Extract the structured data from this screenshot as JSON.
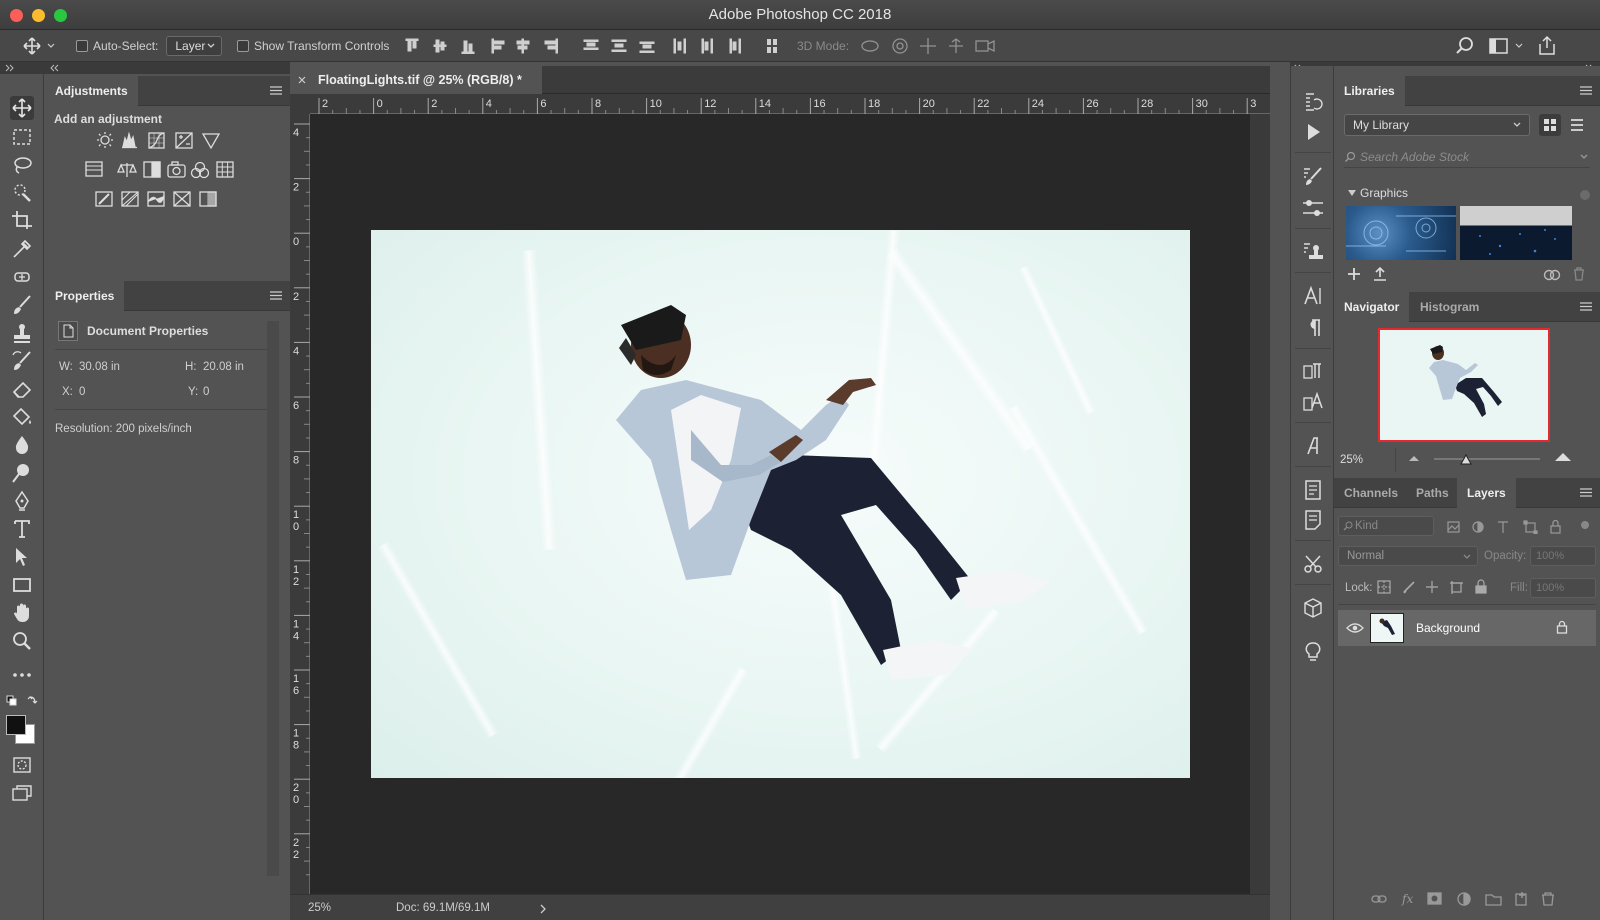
{
  "window": {
    "title": "Adobe Photoshop CC 2018"
  },
  "options_bar": {
    "auto_select_label": "Auto-Select:",
    "auto_select_value": "Layer",
    "show_transform_label": "Show Transform Controls",
    "mode_3d_label": "3D Mode:"
  },
  "adjustments": {
    "title": "Adjustments",
    "subtitle": "Add an adjustment",
    "icons": [
      [
        "brightness-contrast-icon",
        "levels-icon",
        "curves-icon",
        "exposure-icon",
        "vibrance-icon"
      ],
      [
        "hue-saturation-icon",
        "color-balance-icon",
        "black-white-icon",
        "photo-filter-icon",
        "channel-mixer-icon",
        "color-lookup-icon"
      ],
      [
        "invert-icon",
        "posterize-icon",
        "threshold-icon",
        "selective-color-icon",
        "gradient-map-icon"
      ]
    ]
  },
  "properties": {
    "title": "Properties",
    "section": "Document Properties",
    "w_label": "W:",
    "w_value": "30.08 in",
    "h_label": "H:",
    "h_value": "20.08 in",
    "x_label": "X:",
    "x_value": "0",
    "y_label": "Y:",
    "y_value": "0",
    "resolution": "Resolution: 200 pixels/inch"
  },
  "document": {
    "tab_title": "FloatingLights.tif @ 25% (RGB/8) *",
    "ruler_h": [
      "2",
      "0",
      "2",
      "4",
      "6",
      "8",
      "10",
      "12",
      "14",
      "16",
      "18",
      "20",
      "22",
      "24",
      "26",
      "28",
      "30",
      "3"
    ],
    "ruler_v": [
      "4",
      "2",
      "0",
      "2",
      "4",
      "6",
      "8",
      "1\n0",
      "1\n2",
      "1\n4",
      "1\n6",
      "1\n8",
      "2\n0",
      "2\n2"
    ],
    "zoom": "25%",
    "doc_size": "Doc: 69.1M/69.1M"
  },
  "libraries": {
    "title": "Libraries",
    "library_select": "My Library",
    "search_placeholder": "Search Adobe Stock",
    "graphics_label": "Graphics"
  },
  "navigator": {
    "tab_navigator": "Navigator",
    "tab_histogram": "Histogram",
    "zoom": "25%",
    "zoom_slider_fraction": 0.3
  },
  "layers": {
    "tab_channels": "Channels",
    "tab_paths": "Paths",
    "tab_layers": "Layers",
    "kind_placeholder": "Kind",
    "blend_mode": "Normal",
    "opacity_label": "Opacity:",
    "opacity_value": "100%",
    "lock_label": "Lock:",
    "fill_label": "Fill:",
    "fill_value": "100%",
    "items": [
      {
        "name": "Background",
        "visible": true,
        "locked": true
      }
    ]
  },
  "colors": {
    "accent": "#1473e6",
    "panel_bg": "#535353",
    "canvas_bg": "#282828",
    "navigator_frame": "#e5282e"
  }
}
